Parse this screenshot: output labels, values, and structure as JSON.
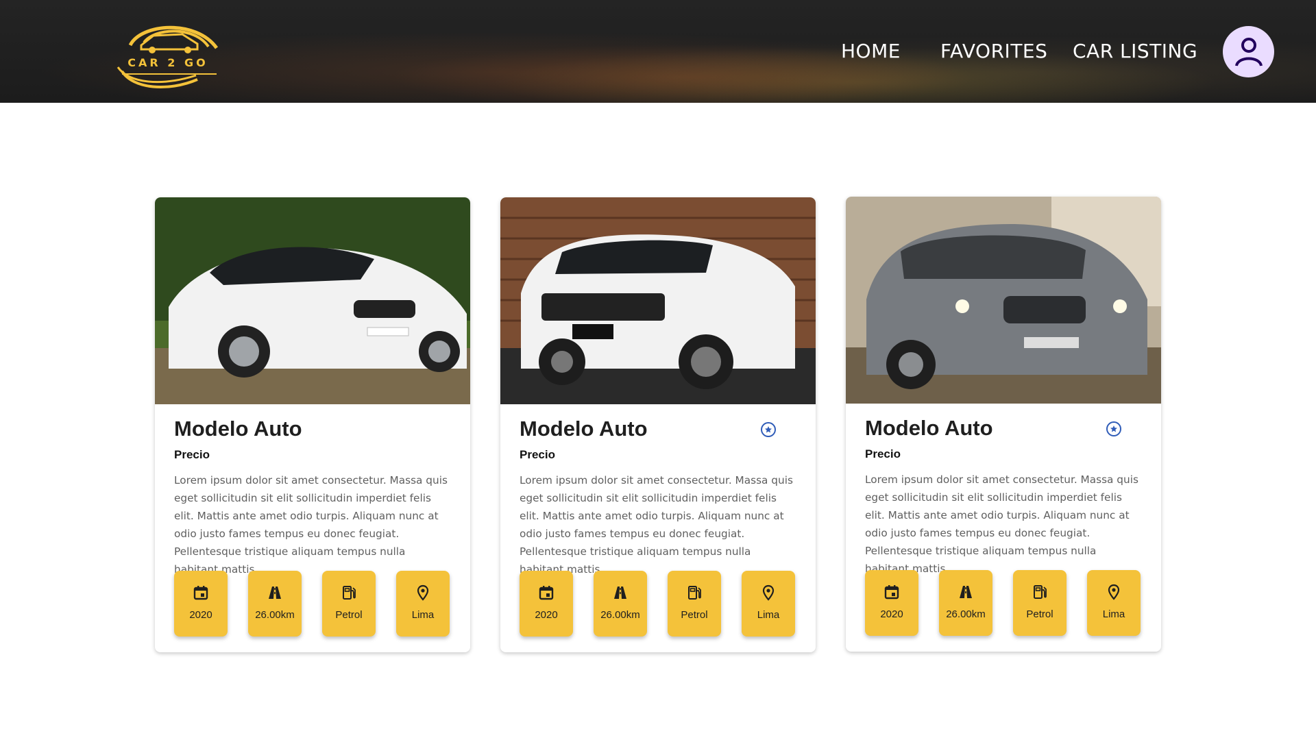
{
  "app": {
    "logo_text": "CAR 2 GO"
  },
  "nav": {
    "items": [
      "HOME",
      "FAVORITES",
      "CAR LISTING"
    ]
  },
  "colors": {
    "accent": "#f4c23a",
    "favorite": "#2f5cb8",
    "header_bg": "#1e1e1e",
    "avatar_bg": "#eadcff"
  },
  "cards": [
    {
      "title": "Modelo Auto",
      "price_label": "Precio",
      "favorite_icon_shown": false,
      "image": "white-sedan",
      "description": "Lorem ipsum dolor sit amet consectetur. Massa quis eget sollicitudin sit elit sollicitudin imperdiet felis elit. Mattis ante amet odio turpis. Aliquam nunc at odio justo fames tempus eu donec feugiat. Pellentesque tristique aliquam tempus nulla habitant mattis.",
      "specs": [
        {
          "icon": "calendar-icon",
          "label": "2020"
        },
        {
          "icon": "road-icon",
          "label": "26.00km"
        },
        {
          "icon": "fuel-icon",
          "label": "Petrol"
        },
        {
          "icon": "location-icon",
          "label": "Lima"
        }
      ]
    },
    {
      "title": "Modelo Auto",
      "price_label": "Precio",
      "favorite_icon_shown": true,
      "image": "white-suv",
      "description": "Lorem ipsum dolor sit amet consectetur. Massa quis eget sollicitudin sit elit sollicitudin imperdiet felis elit. Mattis ante amet odio turpis. Aliquam nunc at odio justo fames tempus eu donec feugiat. Pellentesque tristique aliquam tempus nulla habitant mattis.",
      "specs": [
        {
          "icon": "calendar-icon",
          "label": "2020"
        },
        {
          "icon": "road-icon",
          "label": "26.00km"
        },
        {
          "icon": "fuel-icon",
          "label": "Petrol"
        },
        {
          "icon": "location-icon",
          "label": "Lima"
        }
      ]
    },
    {
      "title": "Modelo Auto",
      "price_label": "Precio",
      "favorite_icon_shown": true,
      "image": "grey-suv",
      "description": "Lorem ipsum dolor sit amet consectetur. Massa quis eget sollicitudin sit elit sollicitudin imperdiet felis elit. Mattis ante amet odio turpis. Aliquam nunc at odio justo fames tempus eu donec feugiat. Pellentesque tristique aliquam tempus nulla habitant mattis.",
      "specs": [
        {
          "icon": "calendar-icon",
          "label": "2020"
        },
        {
          "icon": "road-icon",
          "label": "26.00km"
        },
        {
          "icon": "fuel-icon",
          "label": "Petrol"
        },
        {
          "icon": "location-icon",
          "label": "Lima"
        }
      ]
    }
  ]
}
